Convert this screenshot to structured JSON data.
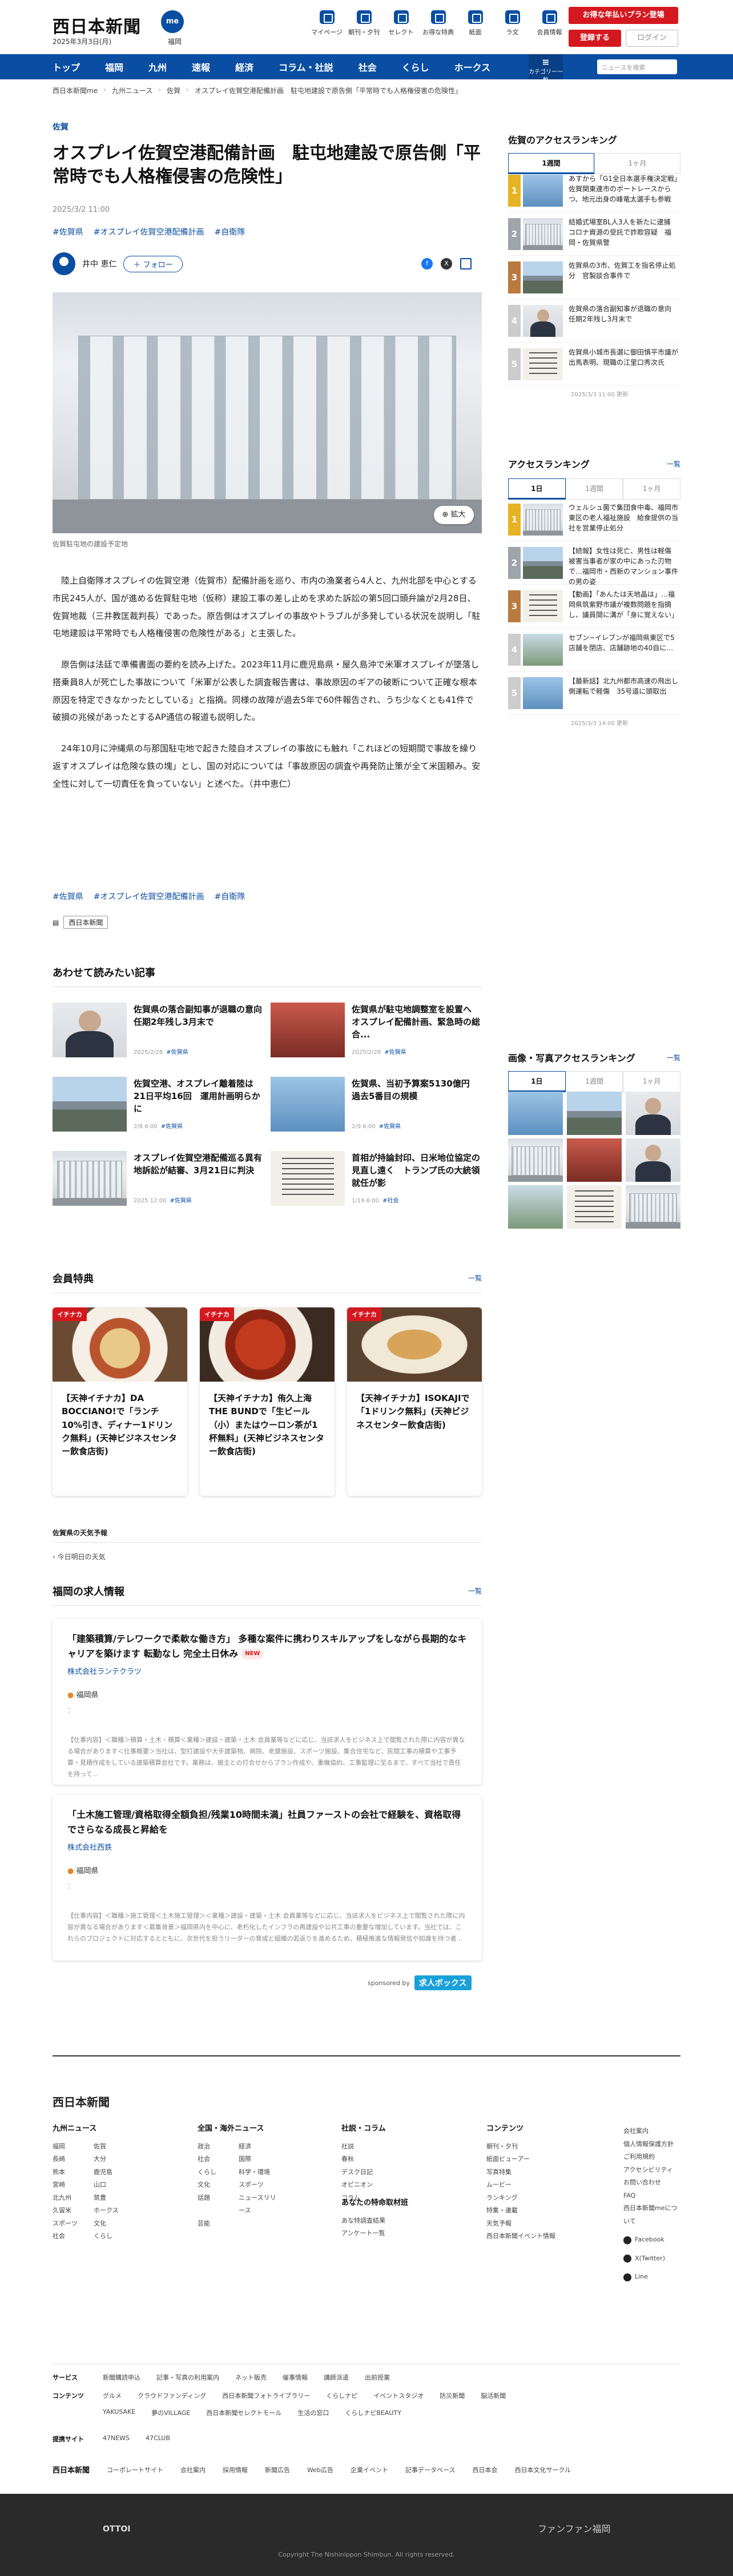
{
  "header": {
    "logo": "西日本新聞",
    "badge": "me",
    "area": "福岡",
    "date": "2025年3月3日(月)",
    "nav": [
      "マイページ",
      "朝刊・夕刊",
      "セレクト",
      "お得な特典",
      "紙面",
      "ラ文",
      "会員情報"
    ],
    "promo": "お得な年払いプラン登場",
    "signup": "登録する",
    "login": "ログイン"
  },
  "gnav": {
    "items": [
      "トップ",
      "福岡",
      "九州",
      "速報",
      "経済",
      "コラム・社説",
      "社会",
      "くらし",
      "ホークス"
    ],
    "category": "カテゴリー一覧",
    "search_placeholder": "ニュースを検索"
  },
  "breadcrumb": [
    "西日本新聞me",
    "九州ニュース",
    "佐賀",
    "オスプレイ佐賀空港配備計画　駐屯地建設で原告側「平常時でも人格権侵害の危険性」"
  ],
  "article": {
    "category": "佐賀",
    "title": "オスプレイ佐賀空港配備計画　駐屯地建設で原告側「平常時でも人格権侵害の危険性」",
    "date": "2025/3/2 11:00",
    "tags": [
      "#佐賀県",
      "#オスプレイ佐賀空港配備計画",
      "#自衛隊"
    ],
    "author": "井中 恵仁",
    "follow": "フォロー",
    "zoom": "拡大",
    "caption": "佐賀駐屯地の建設予定地",
    "paragraphs": [
      "陸上自衛隊オスプレイの佐賀空港（佐賀市）配備計画を巡り、市内の漁業者ら4人と、九州北部を中心とする市民245人が、国が進める佐賀駐屯地（仮称）建設工事の差し止めを求めた訴訟の第5回口頭弁論が2月28日、佐賀地裁（三井教匡裁判長）であった。原告側はオスプレイの事故やトラブルが多発している状況を説明し「駐屯地建設は平常時でも人格権侵害の危険性がある」と主張した。",
      "原告側は法廷で準備書面の要約を読み上げた。2023年11月に鹿児島県・屋久島沖で米軍オスプレイが墜落し搭乗員8人が死亡した事故について「米軍が公表した調査報告書は、事故原因のギアの破断について正確な根本原因を特定できなかったとしている」と指摘。同様の故障が過去5年で60件報告され、うち少なくとも41件で破損の兆候があったとするAP通信の報道も説明した。",
      "24年10月に沖縄県の与那国駐屯地で起きた陸自オスプレイの事故にも触れ「これほどの短期間で事故を繰り返すオスプレイは危険な鉄の塊」とし、国の対応については「事故原因の調査や再発防止策が全て米国頼み。安全性に対して一切責任を負っていない」と述べた。（井中恵仁）"
    ],
    "source": "西日本新聞"
  },
  "related": {
    "heading": "あわせて読みたい記事",
    "items": [
      {
        "title": "佐賀県の落合副知事が退職の意向　任期2年残し3月末で",
        "date": "2025/2/28",
        "tag": "#佐賀県"
      },
      {
        "title": "佐賀県が駐屯地調整室を設置へ　オスプレイ配備計画、緊急時の総合...",
        "date": "2025/2/28",
        "tag": "#佐賀県"
      },
      {
        "title": "佐賀空港、オスプレイ離着陸は21日平均16回　運用計画明らかに",
        "date": "2/8 6:00",
        "tag": "#佐賀県"
      },
      {
        "title": "佐賀県、当初予算案5130億円　過去5番目の規模",
        "date": "2/9 6:00",
        "tag": "#佐賀県"
      },
      {
        "title": "オスプレイ佐賀空港配備巡る異有地訴訟が結審、3月21日に判決",
        "date": "2025 12:00",
        "tag": "#佐賀県"
      },
      {
        "title": "首相が持論封印、日米地位協定の見直し遠く　トランプ氏の大統領就任が影",
        "date": "1/19 6:00",
        "tag": "#社会"
      }
    ]
  },
  "members": {
    "heading": "会員特典",
    "more": "一覧",
    "label": "イチナカ",
    "cards": [
      "【天神イチナカ】DA BOCCIANO!で「ランチ10%引き、ディナー1ドリンク無料」(天神ビジネスセンター飲食店街)",
      "【天神イチナカ】侑久上海 THE BUNDで「生ビール（小）またはウーロン茶が1杯無料」(天神ビジネスセンター飲食店街)",
      "【天神イチナカ】ISOKAJIで「1ドリンク無料」(天神ビジネスセンター飲食店街)"
    ]
  },
  "weather": {
    "heading": "佐賀県の天気予報",
    "link": "今日明日の天気"
  },
  "jobs": {
    "heading": "福岡の求人情報",
    "more": "一覧",
    "new_badge": "NEW",
    "list": [
      {
        "title": "「建築積算/テレワークで柔軟な働き方」 多種な案件に携わりスキルアップをしながら長期的なキャリアを築けます 転勤なし 完全土日休み",
        "company": "株式会社ランテクラツ",
        "location": "福岡県",
        "salary": "：",
        "desc": "【仕事内容】＜職種＞積算・土木・積算＜業種＞建設・建築・土木 会員業等などに応じ、当該求人をビジネス上で閲覧された際に内容が異なる場合があります＜仕事概要＞当社は、型打建設や大手建築物、病院、老健施設、スポーツ施設、集合住宅など、民間工事の積算や工事予算・見積作成をしている建築積算会社です。業務は、施主との打合せからプラン作成や、重機協約、工事監理に至るまで、すべて当社で責任を持って..."
      },
      {
        "title": "「土木施工管理/資格取得全額負担/残業10時間未満」社員ファーストの会社で経験を、資格取得でさらなる成長と昇給を",
        "company": "株式会社西鉄",
        "location": "福岡県",
        "salary": "：",
        "desc": "【仕事内容】＜職種＞施工管理＜土木施工管理＞＜業種＞建設・建築・土木 会員業等などに応じ、当該求人をビジネス上で閲覧された際に内容が異なる場合があります＜募集背景＞福岡県内を中心に、老朽化したインフラの再建設や公共工事の重要な増加しています。当社では、これらのプロジェクトに対応するとともに、次世代を担うリーダーの育成と組織の若返りを進めるため、積極推進な情報発信や知識を持つ者..."
      }
    ],
    "sponsor_label": "sponsored by",
    "sponsor": "求人ボックス"
  },
  "sidebar": {
    "saga_rank": {
      "heading": "佐賀のアクセスランキング",
      "tabs": [
        "1週間",
        "1ヶ月"
      ],
      "items": [
        "あすから「G1全日本選手権決定戦」佐賀関東連市のボートレースからつ、地元出身の峰竜太選手も参戦",
        "結婚式場室BL人3人を新たに逮捕　コロナ資源の受託で詐欺容疑　福岡・佐賀県警",
        "佐賀県の3市、佐賀工を指名停止処分　官製談合事件で",
        "佐賀県の落合副知事が退職の意向　任期2年残し3月末で",
        "佐賀県小城市長選に御田慎平市議が出馬表明、現職の江里口秀次氏"
      ],
      "time": "2025/3/3 11:00 更新"
    },
    "access_rank": {
      "heading": "アクセスランキング",
      "more": "一覧",
      "tabs": [
        "1日",
        "1週間",
        "1ヶ月"
      ],
      "items": [
        "ウェルシュ菌で集団食中毒、福岡市東区の老人福祉施設　給食提供の当社を営業停止処分",
        "【続報】女性は死亡、男性は軽傷　被害当事者が家の中にあった刃物で…福岡市・西新のマンション事件の男の姿",
        "【動画】「あんたは天地晶は」…福岡県筑紫野市議が複数問題を指摘し、議員間に溝が「身に覚えない」",
        "セブン−イレブンが福岡県東区で5店舗を閉店、店舗跡地の40自に…",
        "【最新話】北九州都市高速の飛出し側運転で軽傷　35号道に頭取出"
      ],
      "time": "2025/3/3 14:00 更新"
    },
    "gallery": {
      "heading": "画像・写真アクセスランキング",
      "more": "一覧",
      "tabs": [
        "1日",
        "1週間",
        "1ヶ月"
      ]
    }
  },
  "footer": {
    "logo": "西日本新聞",
    "columns": [
      {
        "heading": "九州ニュース",
        "items": [
          "福岡",
          "佐賀",
          "長崎",
          "大分",
          "熊本",
          "鹿児島",
          "宮崎",
          "山口",
          "北九州",
          "筑豊",
          "久留米",
          "ホークス",
          "スポーツ",
          "文化",
          "社会",
          "くらし"
        ]
      },
      {
        "heading": "全国・海外ニュース",
        "items": [
          "政治",
          "経済",
          "社会",
          "国際",
          "くらし",
          "科学・環境",
          "文化",
          "スポーツ",
          "話題",
          "ニュースリリース",
          "芸能"
        ]
      },
      {
        "heading": "社説・コラム",
        "items": [
          "社説",
          "春秋",
          "デスク日記",
          "オピニオン",
          "コラム"
        ]
      },
      {
        "heading": "コンテンツ",
        "items": [
          "朝刊・夕刊",
          "紙面ビューアー",
          "写真特集",
          "ムービー",
          "ランキング",
          "特集・連載",
          "天気予報",
          "西日本新聞イベント情報"
        ]
      }
    ],
    "sub_heading": "あなたの特命取材班",
    "sub_items": [
      "あな特調査結果",
      "アンケート一覧"
    ],
    "right": [
      "会社案内",
      "個人情報保護方針",
      "ご利用規約",
      "アクセシビリティ",
      "お問い合わせ",
      "FAQ",
      "西日本新聞meについて"
    ],
    "sns": [
      "Facebook",
      "X(Twitter)",
      "Line"
    ],
    "rows": [
      {
        "label": "サービス",
        "items": [
          "新聞購読申込",
          "記事・写真の利用案内",
          "ネット販売",
          "催事情報",
          "講師派遣",
          "出前授業"
        ]
      },
      {
        "label": "コンテンツ",
        "items": [
          "グルメ",
          "クラウドファンディング",
          "西日本新聞フォトライブラリー",
          "くらしナビ",
          "イベントスタジオ",
          "防災新聞",
          "脳活新聞"
        ]
      },
      {
        "label": "",
        "items": [
          "YAKUSAKE",
          "夢のVILLAGE",
          "西日本新聞セレクトモール",
          "生活の窓口",
          "くらしナビBEAUTY"
        ]
      },
      {
        "label": "提携サイト",
        "items": [
          "47NEWS",
          "47CLUB"
        ]
      }
    ],
    "bottom": [
      "西日本新聞",
      "コーポレートサイト",
      "会社案内",
      "採用情報",
      "新聞広告",
      "Web広告",
      "企業イベント",
      "記事データベース",
      "西日本会",
      "西日本文化サークル"
    ],
    "dark_left": "OTTOI",
    "dark_right": "ファンファン福岡",
    "copyright": "Copyright The Nishinippon Shimbun. All rights reserved."
  }
}
